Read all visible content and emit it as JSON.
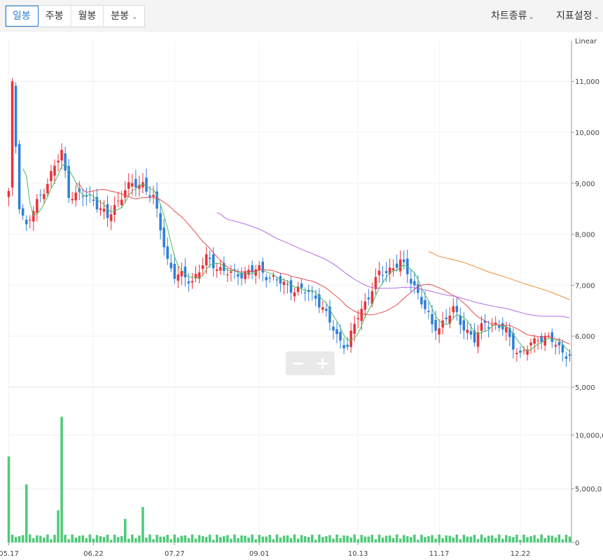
{
  "toolbar": {
    "tabs": [
      {
        "label": "일봉",
        "active": true
      },
      {
        "label": "주봉",
        "active": false
      },
      {
        "label": "월봉",
        "active": false
      },
      {
        "label": "분봉",
        "active": false,
        "dropdown": true
      }
    ],
    "chart_type_label": "차트종류",
    "indicator_label": "지표설정"
  },
  "zoom": {
    "minus_label": "−",
    "plus_label": "+"
  },
  "colors": {
    "up": "#e8333b",
    "down": "#2f7fd8",
    "volume": "#4fc97a",
    "ma5": "#4cbb5f",
    "ma20": "#e84a4a",
    "ma60": "#b36be6",
    "ma120": "#f0903a"
  },
  "chart_data": [
    {
      "type": "candlestick",
      "scale_label": "Linear",
      "x_tick_labels": [
        "05.17",
        "06.22",
        "07.27",
        "09.01",
        "10.13",
        "11.17",
        "12.22"
      ],
      "y_ticks": [
        5000,
        6000,
        7000,
        8000,
        9000,
        10000,
        11000
      ],
      "y_tick_labels": [
        "5,000",
        "6,000",
        "7,000",
        "8,000",
        "9,000",
        "10,000",
        "11,000"
      ],
      "ylim": [
        5000,
        11800
      ],
      "grid": true,
      "n_sessions": 160,
      "key_points": [
        {
          "label": "05.17",
          "close": 8800
        },
        {
          "label": "05.18",
          "close": 10900
        },
        {
          "label": "05.21",
          "close": 8600
        },
        {
          "label": "05.24",
          "close": 8150
        },
        {
          "label": "06.01",
          "close": 8900
        },
        {
          "label": "06.09",
          "close": 9600
        },
        {
          "label": "06.12",
          "close": 8800
        },
        {
          "label": "06.22",
          "close": 8700
        },
        {
          "label": "06.29",
          "close": 8300
        },
        {
          "label": "07.05",
          "close": 8900
        },
        {
          "label": "07.13",
          "close": 9000
        },
        {
          "label": "07.17",
          "close": 8700
        },
        {
          "label": "07.24",
          "close": 7500
        },
        {
          "label": "07.27",
          "close": 7200
        },
        {
          "label": "08.03",
          "close": 7100
        },
        {
          "label": "08.10",
          "close": 7500
        },
        {
          "label": "08.20",
          "close": 7200
        },
        {
          "label": "09.01",
          "close": 7300
        },
        {
          "label": "09.12",
          "close": 7000
        },
        {
          "label": "09.26",
          "close": 6800
        },
        {
          "label": "10.04",
          "close": 6000
        },
        {
          "label": "10.08",
          "close": 5800
        },
        {
          "label": "10.13",
          "close": 6400
        },
        {
          "label": "10.23",
          "close": 7200
        },
        {
          "label": "10.31",
          "close": 7450
        },
        {
          "label": "11.07",
          "close": 7000
        },
        {
          "label": "11.14",
          "close": 6200
        },
        {
          "label": "11.17",
          "close": 6200
        },
        {
          "label": "11.24",
          "close": 6500
        },
        {
          "label": "12.01",
          "close": 5900
        },
        {
          "label": "12.07",
          "close": 6300
        },
        {
          "label": "12.15",
          "close": 6100
        },
        {
          "label": "12.22",
          "close": 5600
        },
        {
          "label": "12.29",
          "close": 6000
        },
        {
          "label": "01.05",
          "close": 5900
        },
        {
          "label": "01.12",
          "close": 5600
        }
      ],
      "moving_averages": [
        {
          "period": 5,
          "key": "ma5"
        },
        {
          "period": 20,
          "key": "ma20"
        },
        {
          "period": 60,
          "key": "ma60"
        },
        {
          "period": 120,
          "key": "ma120"
        }
      ]
    },
    {
      "type": "bar",
      "y_ticks": [
        0,
        5000000,
        10000000
      ],
      "y_tick_labels": [
        "0",
        "5,000,0",
        "10,000,0"
      ],
      "ylim": [
        0,
        14000000
      ],
      "peaks": [
        {
          "label": "05.17",
          "volume": 8000000
        },
        {
          "label": "05.17",
          "volume": 4300000
        },
        {
          "label": "05.25",
          "volume": 5400000
        },
        {
          "label": "06.09",
          "volume": 11700000
        },
        {
          "label": "06.07",
          "volume": 3000000
        },
        {
          "label": "07.13",
          "volume": 3300000
        },
        {
          "label": "07.05",
          "volume": 2200000
        }
      ]
    }
  ]
}
